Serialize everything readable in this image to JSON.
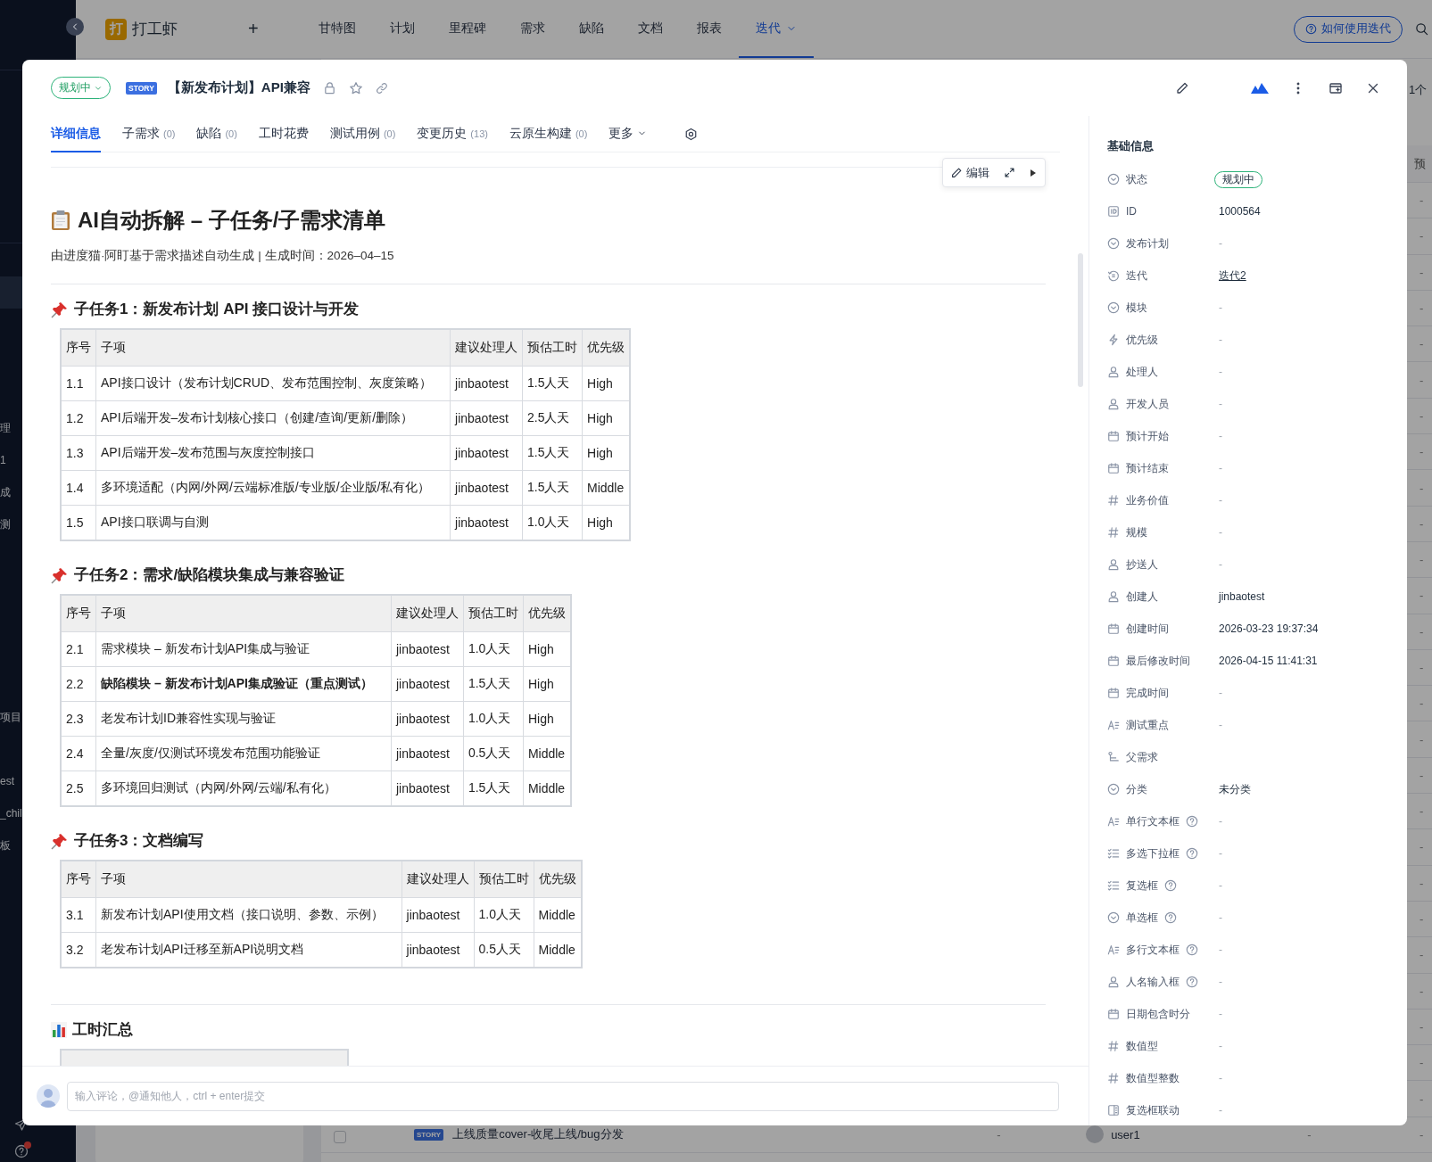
{
  "background": {
    "sidebar": {
      "groups": [
        [
          "理",
          "1",
          "成",
          "测"
        ],
        [
          "项目"
        ],
        [
          "est",
          "_chil",
          "板"
        ]
      ]
    },
    "topbar": {
      "logo_letter": "打",
      "app_name": "打工虾",
      "add": "+",
      "nav": [
        {
          "label": "甘特图",
          "selected": false,
          "dropdown": false
        },
        {
          "label": "计划",
          "selected": false,
          "dropdown": false
        },
        {
          "label": "里程碑",
          "selected": false,
          "dropdown": false
        },
        {
          "label": "需求",
          "selected": false,
          "dropdown": false
        },
        {
          "label": "缺陷",
          "selected": false,
          "dropdown": false
        },
        {
          "label": "文档",
          "selected": false,
          "dropdown": false
        },
        {
          "label": "报表",
          "selected": false,
          "dropdown": false
        },
        {
          "label": "迭代",
          "selected": true,
          "dropdown": true
        }
      ],
      "help_button": "如何使用迭代"
    },
    "list": {
      "toolbar_text": "1个",
      "header_text": "预",
      "rows": [
        {
          "last": "-"
        },
        {
          "last": "-"
        },
        {
          "last": "-"
        },
        {
          "last": "-"
        },
        {
          "last": "-"
        },
        {
          "last": "-"
        },
        {
          "last": "-"
        },
        {
          "last": "-"
        },
        {
          "last": "-"
        },
        {
          "last": "-"
        },
        {
          "last": "-"
        },
        {
          "last": "-"
        },
        {
          "last": "-"
        },
        {
          "last": "-"
        },
        {
          "last": "-"
        },
        {
          "last": "-"
        },
        {
          "last": "-"
        },
        {
          "last": "-"
        },
        {
          "last": "-"
        },
        {
          "last": "-"
        },
        {
          "last": "-"
        },
        {
          "last": "-"
        },
        {
          "last": "-"
        },
        {
          "last": "-"
        },
        {
          "last": "-"
        },
        {
          "last": "-"
        },
        {
          "checked": false,
          "badge": "STORY",
          "title": "上线质量cover-收尾上线/bug分发",
          "col_a": "-",
          "assignee": "user1",
          "col_b": "-",
          "last": "-"
        }
      ]
    }
  },
  "modal": {
    "header": {
      "status": "规划中",
      "badge": "STORY",
      "title": "【新发布计划】API兼容"
    },
    "tabs": [
      {
        "label": "详细信息",
        "selected": true,
        "kind": "plain"
      },
      {
        "label": "子需求",
        "count": "(0)",
        "selected": false,
        "kind": "plain"
      },
      {
        "label": "缺陷",
        "count": "(0)",
        "selected": false,
        "kind": "plain"
      },
      {
        "label": "工时花费",
        "selected": false,
        "kind": "plain"
      },
      {
        "label": "测试用例",
        "count": "(0)",
        "selected": false,
        "kind": "plain"
      },
      {
        "label": "变更历史",
        "count": "(13)",
        "selected": false,
        "kind": "plain"
      },
      {
        "label": "云原生构建",
        "count": "(0)",
        "selected": false,
        "kind": "plain"
      },
      {
        "label": "更多",
        "selected": false,
        "kind": "dropdown"
      }
    ],
    "editor_toolbar": {
      "edit": "编辑"
    },
    "document": {
      "title": "AI自动拆解 – 子任务/子需求清单",
      "meta": "由进度猫·阿盯基于需求描述自动生成 | 生成时间：2026–04–15",
      "sections": [
        {
          "heading": "子任务1：新发布计划 API 接口设计与开发",
          "columns": [
            "序号",
            "子项",
            "建议处理人",
            "预估工时",
            "优先级"
          ],
          "rows": [
            {
              "bold": false,
              "cells": [
                "1.1",
                "API接口设计（发布计划CRUD、发布范围控制、灰度策略）",
                "jinbaotest",
                "1.5人天",
                "High"
              ]
            },
            {
              "bold": false,
              "cells": [
                "1.2",
                "API后端开发–发布计划核心接口（创建/查询/更新/删除）",
                "jinbaotest",
                "2.5人天",
                "High"
              ]
            },
            {
              "bold": false,
              "cells": [
                "1.3",
                "API后端开发–发布范围与灰度控制接口",
                "jinbaotest",
                "1.5人天",
                "High"
              ]
            },
            {
              "bold": false,
              "cells": [
                "1.4",
                "多环境适配（内网/外网/云端标准版/专业版/企业版/私有化）",
                "jinbaotest",
                "1.5人天",
                "Middle"
              ]
            },
            {
              "bold": false,
              "cells": [
                "1.5",
                "API接口联调与自测",
                "jinbaotest",
                "1.0人天",
                "High"
              ]
            }
          ]
        },
        {
          "heading": "子任务2：需求/缺陷模块集成与兼容验证",
          "columns": [
            "序号",
            "子项",
            "建议处理人",
            "预估工时",
            "优先级"
          ],
          "rows": [
            {
              "bold": false,
              "cells": [
                "2.1",
                "需求模块 – 新发布计划API集成与验证",
                "jinbaotest",
                "1.0人天",
                "High"
              ]
            },
            {
              "bold": true,
              "cells": [
                "2.2",
                "缺陷模块 – 新发布计划API集成验证（重点测试）",
                "jinbaotest",
                "1.5人天",
                "High"
              ]
            },
            {
              "bold": false,
              "cells": [
                "2.3",
                "老发布计划ID兼容性实现与验证",
                "jinbaotest",
                "1.0人天",
                "High"
              ]
            },
            {
              "bold": false,
              "cells": [
                "2.4",
                "全量/灰度/仅测试环境发布范围功能验证",
                "jinbaotest",
                "0.5人天",
                "Middle"
              ]
            },
            {
              "bold": false,
              "cells": [
                "2.5",
                "多环境回归测试（内网/外网/云端/私有化）",
                "jinbaotest",
                "1.5人天",
                "Middle"
              ]
            }
          ]
        },
        {
          "heading": "子任务3：文档编写",
          "columns": [
            "序号",
            "子项",
            "建议处理人",
            "预估工时",
            "优先级"
          ],
          "rows": [
            {
              "bold": false,
              "cells": [
                "3.1",
                "新发布计划API使用文档（接口说明、参数、示例）",
                "jinbaotest",
                "1.0人天",
                "Middle"
              ]
            },
            {
              "bold": false,
              "cells": [
                "3.2",
                "老发布计划API迁移至新API说明文档",
                "jinbaotest",
                "0.5人天",
                "Middle"
              ]
            }
          ]
        }
      ],
      "summary_heading": "工时汇总"
    },
    "comment": {
      "placeholder": "输入评论，@通知他人，ctrl + enter提交"
    },
    "panel": {
      "heading": "基础信息",
      "fields": [
        {
          "kind": "status",
          "label": "状态",
          "help": false,
          "value": "规划中"
        },
        {
          "kind": "id",
          "label": "ID",
          "help": false,
          "value": "1000564"
        },
        {
          "kind": "select",
          "label": "发布计划",
          "help": false,
          "placeholder": "-"
        },
        {
          "kind": "iteration",
          "label": "迭代",
          "help": false,
          "value": "迭代2"
        },
        {
          "kind": "select",
          "label": "模块",
          "help": false,
          "placeholder": "-"
        },
        {
          "kind": "priority",
          "label": "优先级",
          "help": false,
          "placeholder": "-"
        },
        {
          "kind": "person",
          "label": "处理人",
          "help": false,
          "placeholder": "-"
        },
        {
          "kind": "person",
          "label": "开发人员",
          "help": false,
          "placeholder": "-"
        },
        {
          "kind": "date",
          "label": "预计开始",
          "help": false,
          "placeholder": "-"
        },
        {
          "kind": "date",
          "label": "预计结束",
          "help": false,
          "placeholder": "-"
        },
        {
          "kind": "number",
          "label": "业务价值",
          "help": false,
          "placeholder": "-"
        },
        {
          "kind": "number",
          "label": "规模",
          "help": false,
          "placeholder": "-"
        },
        {
          "kind": "person",
          "label": "抄送人",
          "help": false,
          "placeholder": "-"
        },
        {
          "kind": "person",
          "label": "创建人",
          "help": false,
          "value": "jinbaotest"
        },
        {
          "kind": "date",
          "label": "创建时间",
          "help": false,
          "value": "2026-03-23 19:37:34"
        },
        {
          "kind": "date",
          "label": "最后修改时间",
          "help": false,
          "value": "2026-04-15 11:41:31"
        },
        {
          "kind": "date",
          "label": "完成时间",
          "help": false,
          "placeholder": "-"
        },
        {
          "kind": "text",
          "label": "测试重点",
          "help": false,
          "placeholder": "-"
        },
        {
          "kind": "parent",
          "label": "父需求",
          "help": false
        },
        {
          "kind": "select",
          "label": "分类",
          "help": false,
          "value": "未分类"
        },
        {
          "kind": "text",
          "label": "单行文本框",
          "help": true,
          "placeholder": "-"
        },
        {
          "kind": "multiselect",
          "label": "多选下拉框",
          "help": true,
          "placeholder": "-"
        },
        {
          "kind": "multiselect",
          "label": "复选框",
          "help": true,
          "placeholder": "-"
        },
        {
          "kind": "select",
          "label": "单选框",
          "help": true,
          "placeholder": "-"
        },
        {
          "kind": "text",
          "label": "多行文本框",
          "help": true,
          "placeholder": "-"
        },
        {
          "kind": "person",
          "label": "人名输入框",
          "help": true,
          "placeholder": "-"
        },
        {
          "kind": "date",
          "label": "日期包含时分",
          "help": false,
          "placeholder": "-"
        },
        {
          "kind": "number",
          "label": "数值型",
          "help": false,
          "placeholder": "-"
        },
        {
          "kind": "number",
          "label": "数值型整数",
          "help": false,
          "placeholder": "-"
        },
        {
          "kind": "linkage",
          "label": "复选框联动",
          "help": false,
          "placeholder": "-"
        }
      ]
    }
  }
}
